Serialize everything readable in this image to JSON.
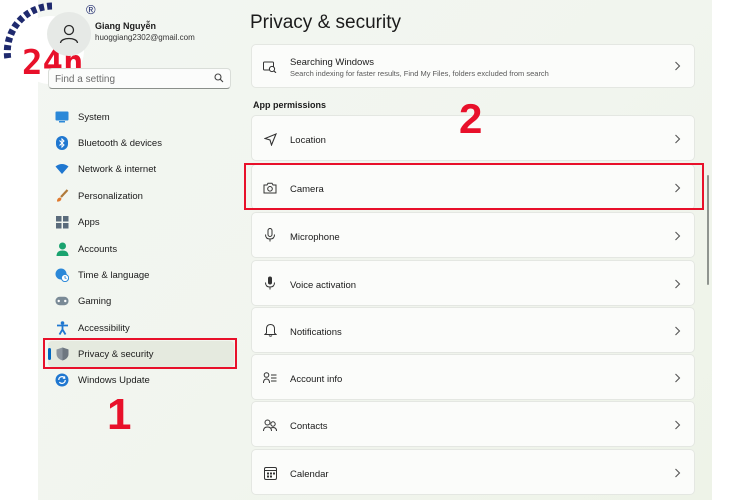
{
  "watermark": {
    "brand": "24h",
    "registered": "®"
  },
  "account": {
    "name": "Giang Nguyễn",
    "email": "huoggiang2302@gmail.com"
  },
  "search": {
    "placeholder": "Find a setting"
  },
  "sidebar": {
    "items": [
      {
        "label": "System",
        "icon": "system-icon",
        "selected": false
      },
      {
        "label": "Bluetooth & devices",
        "icon": "bluetooth-icon",
        "selected": false
      },
      {
        "label": "Network & internet",
        "icon": "wifi-icon",
        "selected": false
      },
      {
        "label": "Personalization",
        "icon": "brush-icon",
        "selected": false
      },
      {
        "label": "Apps",
        "icon": "apps-icon",
        "selected": false
      },
      {
        "label": "Accounts",
        "icon": "person-icon",
        "selected": false
      },
      {
        "label": "Time & language",
        "icon": "globe-clock-icon",
        "selected": false
      },
      {
        "label": "Gaming",
        "icon": "gamepad-icon",
        "selected": false
      },
      {
        "label": "Accessibility",
        "icon": "accessibility-icon",
        "selected": false
      },
      {
        "label": "Privacy & security",
        "icon": "shield-icon",
        "selected": true
      },
      {
        "label": "Windows Update",
        "icon": "update-icon",
        "selected": false
      }
    ]
  },
  "main": {
    "title": "Privacy & security",
    "top_card": {
      "title": "Searching Windows",
      "subtitle": "Search indexing for faster results, Find My Files, folders excluded from search",
      "icon": "search-windows-icon"
    },
    "section_label": "App permissions",
    "permissions": [
      {
        "label": "Location",
        "icon": "location-icon"
      },
      {
        "label": "Camera",
        "icon": "camera-icon"
      },
      {
        "label": "Microphone",
        "icon": "microphone-icon"
      },
      {
        "label": "Voice activation",
        "icon": "voice-icon"
      },
      {
        "label": "Notifications",
        "icon": "bell-icon"
      },
      {
        "label": "Account info",
        "icon": "account-info-icon"
      },
      {
        "label": "Contacts",
        "icon": "contacts-icon"
      },
      {
        "label": "Calendar",
        "icon": "calendar-icon"
      }
    ]
  },
  "annotations": {
    "step1": "1",
    "step2": "2"
  },
  "colors": {
    "highlight": "#e8102a",
    "accent": "#0067c0",
    "brand_red": "#e8102a",
    "brand_blue": "#1f2a6e"
  }
}
